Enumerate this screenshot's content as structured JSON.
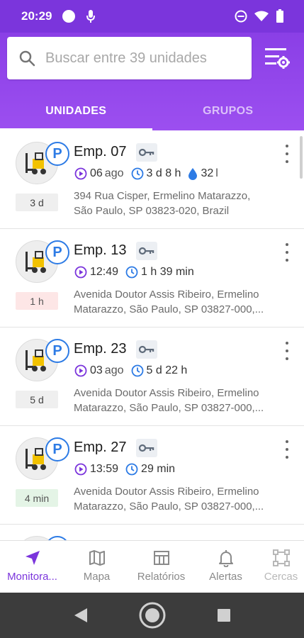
{
  "status_bar": {
    "time": "20:29"
  },
  "search": {
    "placeholder": "Buscar entre 39 unidades",
    "value": ""
  },
  "tabs": [
    {
      "label": "UNIDADES",
      "active": true
    },
    {
      "label": "GRUPOS",
      "active": false
    }
  ],
  "colors": {
    "primary": "#7b35dc",
    "parking_badge": "#2d7be5",
    "clock_icon": "#2d7be5",
    "play_icon": "#7b35dc"
  },
  "units": [
    {
      "name": "Emp. 07",
      "badge": "P",
      "duration": "3 d",
      "duration_style": "gray",
      "stat1": "06",
      "stat1_sub": "ago",
      "stat2": "3 d 8 h",
      "fuel": "32",
      "fuel_unit": "l",
      "address_line1": "394 Rua Cisper, Ermelino Matarazzo,",
      "address_line2": "São Paulo, SP 03823-020, Brazil"
    },
    {
      "name": "Emp. 13",
      "badge": "P",
      "duration": "1 h",
      "duration_style": "red",
      "stat1": "12:49",
      "stat1_sub": "",
      "stat2": "1 h 39 min",
      "address_line1": "Avenida Doutor Assis Ribeiro, Ermelino",
      "address_line2": "Matarazzo, São Paulo, SP 03827-000,..."
    },
    {
      "name": "Emp. 23",
      "badge": "P",
      "duration": "5 d",
      "duration_style": "gray",
      "stat1": "03",
      "stat1_sub": "ago",
      "stat2": "5 d 22 h",
      "address_line1": "Avenida Doutor Assis Ribeiro, Ermelino",
      "address_line2": "Matarazzo, São Paulo, SP 03827-000,..."
    },
    {
      "name": "Emp. 27",
      "badge": "P",
      "duration": "4 min",
      "duration_style": "green",
      "stat1": "13:59",
      "stat1_sub": "",
      "stat2": "29 min",
      "address_line1": "Avenida Doutor Assis Ribeiro, Ermelino",
      "address_line2": "Matarazzo, São Paulo, SP 03827-000,..."
    }
  ],
  "bottom_nav": [
    {
      "label": "Monitora...",
      "icon": "navigation-arrow-icon",
      "active": true
    },
    {
      "label": "Mapa",
      "icon": "map-icon",
      "active": false
    },
    {
      "label": "Relatórios",
      "icon": "reports-icon",
      "active": false
    },
    {
      "label": "Alertas",
      "icon": "bell-icon",
      "active": false
    },
    {
      "label": "Cercas",
      "icon": "geofence-icon",
      "active": false
    }
  ]
}
